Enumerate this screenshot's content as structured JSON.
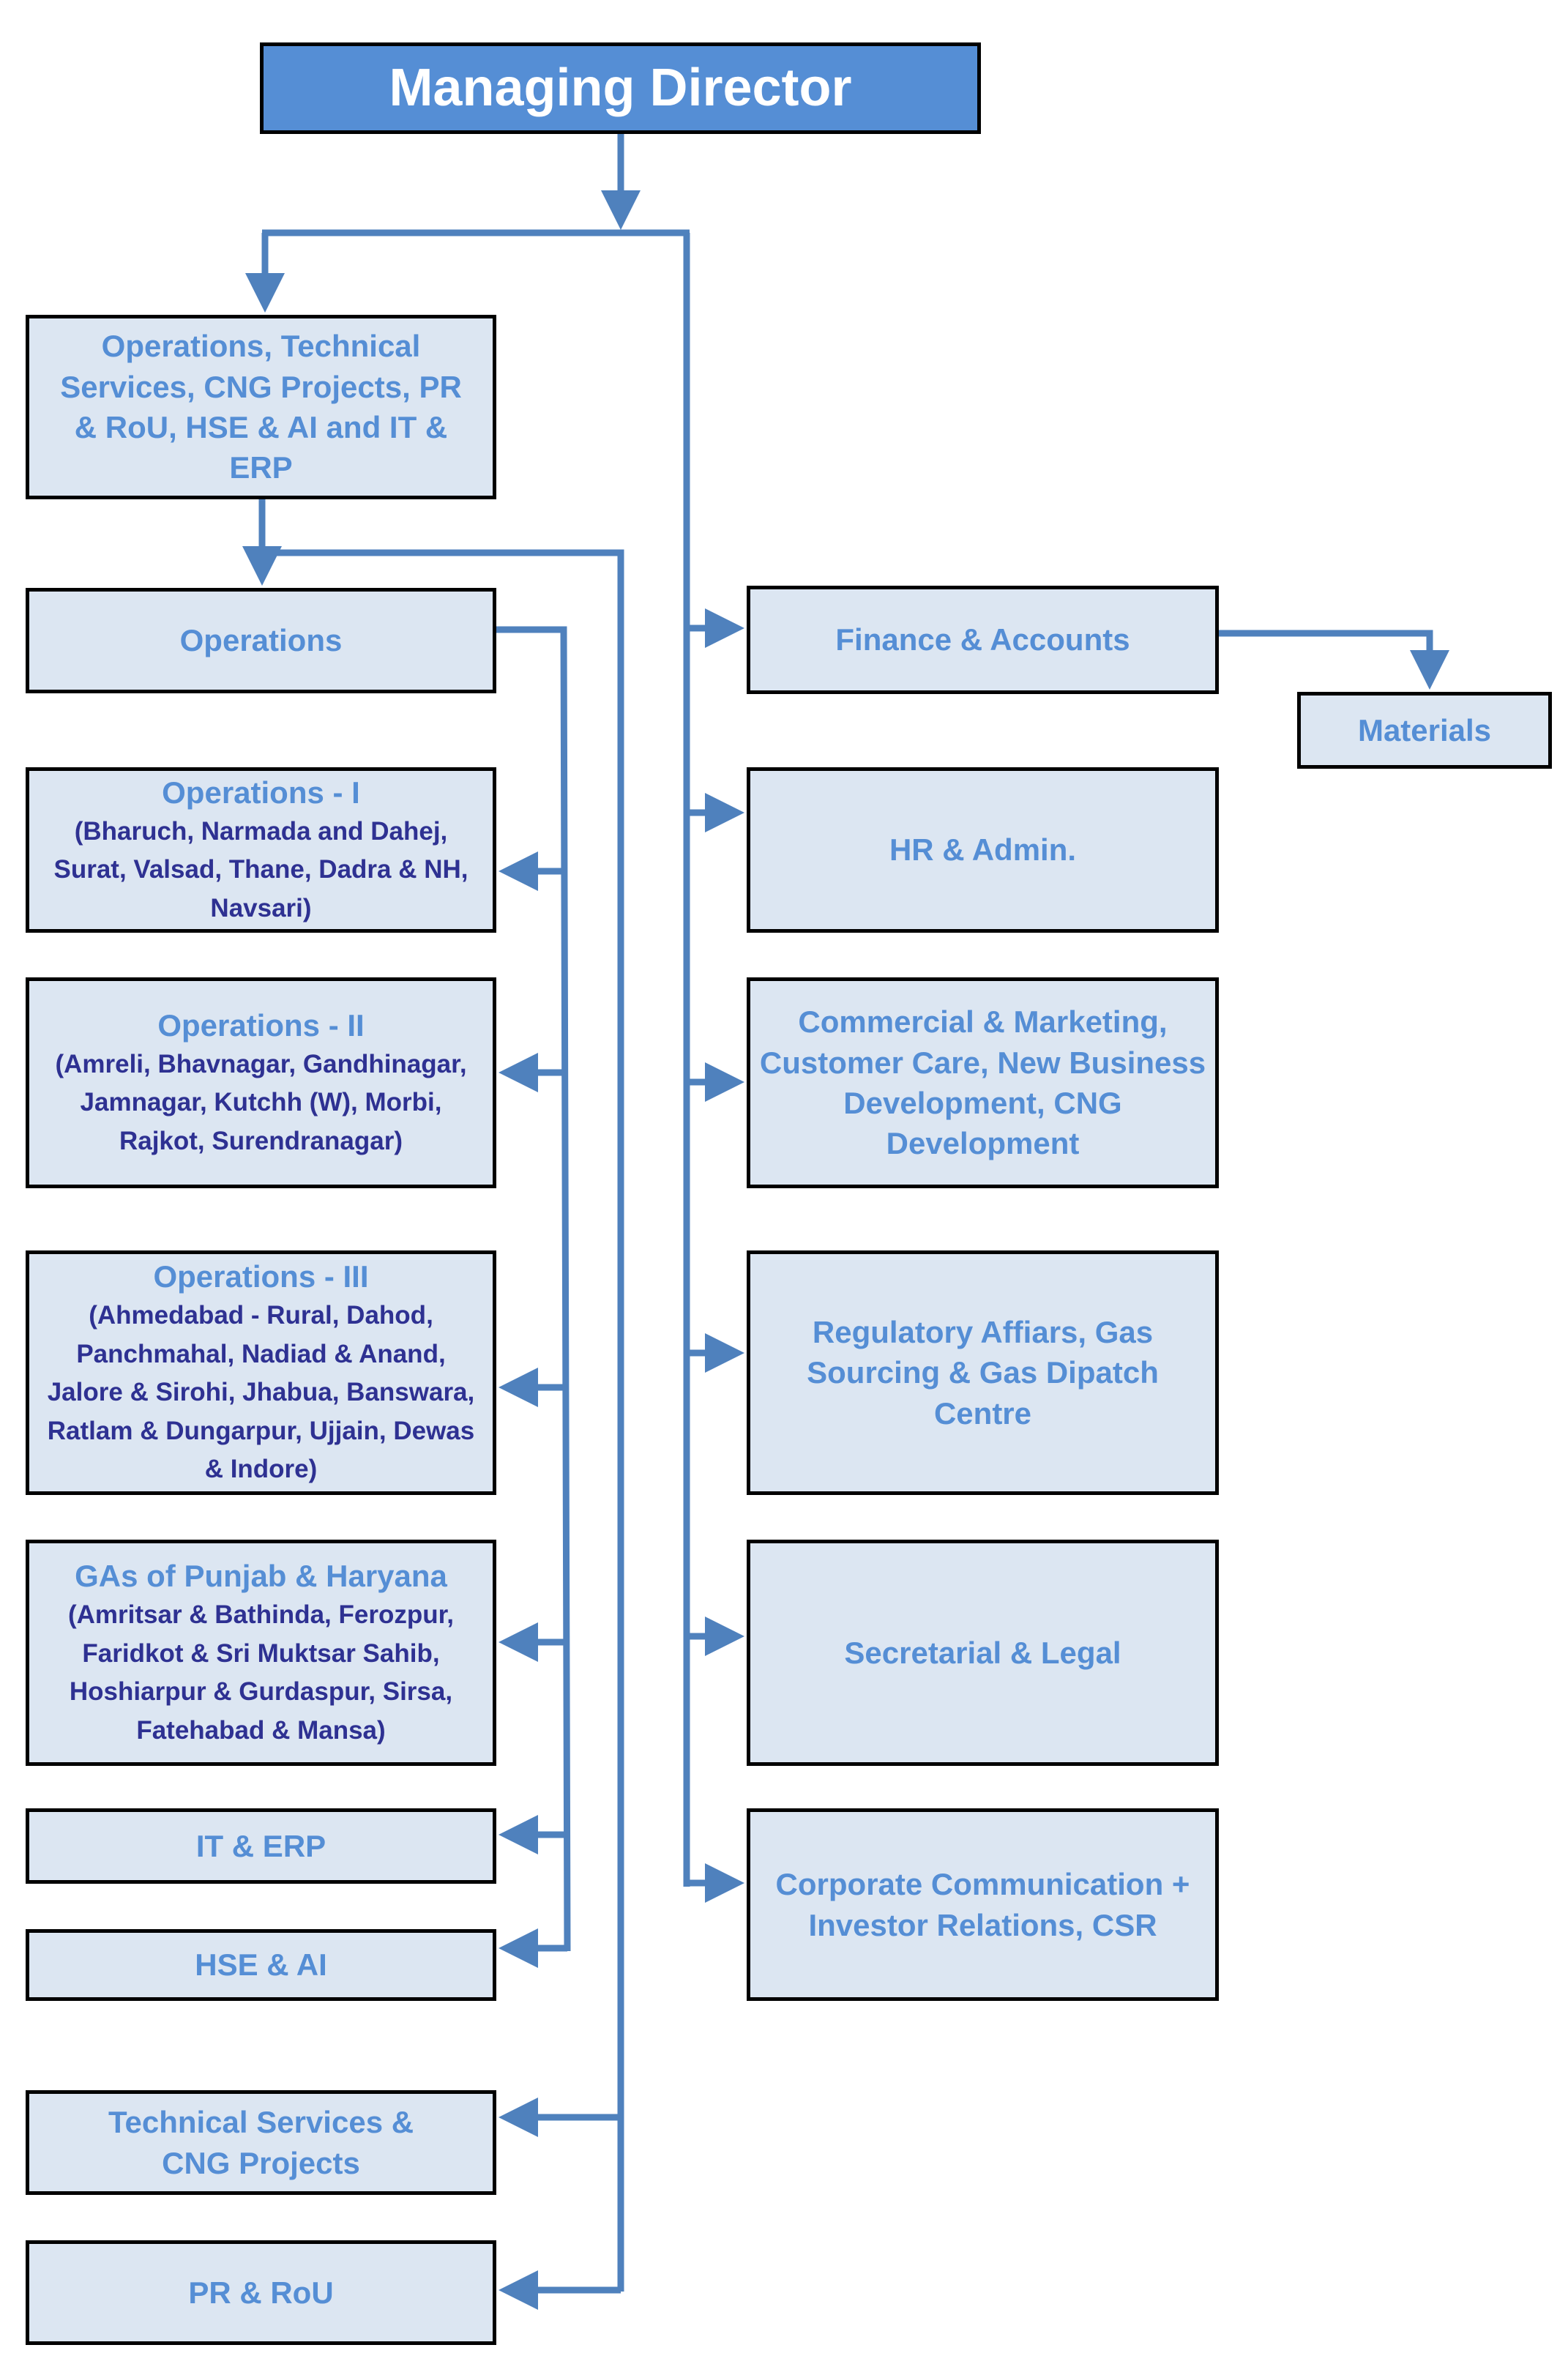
{
  "colors": {
    "connector": "#4f81bd",
    "box_fill": "#dce6f2",
    "box_border": "#000000",
    "title_text": "#558ed5",
    "subtitle_text": "#2e3192",
    "root_fill": "#558ed5",
    "root_text": "#ffffff"
  },
  "root": {
    "label": "Managing Director"
  },
  "left_branch": {
    "head": {
      "label": "Operations, Technical Services, CNG Projects, PR & RoU, HSE & AI and IT & ERP"
    },
    "operations": {
      "label": "Operations"
    },
    "ops_children": [
      {
        "title": "Operations - I",
        "detail": "(Bharuch, Narmada and Dahej, Surat, Valsad, Thane, Dadra & NH, Navsari)"
      },
      {
        "title": "Operations - II",
        "detail": "(Amreli, Bhavnagar, Gandhinagar, Jamnagar, Kutchh (W), Morbi, Rajkot, Surendranagar)"
      },
      {
        "title": "Operations - III",
        "detail": "(Ahmedabad - Rural, Dahod, Panchmahal, Nadiad & Anand, Jalore & Sirohi, Jhabua, Banswara, Ratlam & Dungarpur, Ujjain, Dewas & Indore)"
      },
      {
        "title": "GAs of Punjab & Haryana",
        "detail": "(Amritsar & Bathinda, Ferozpur, Faridkot & Sri Muktsar Sahib, Hoshiarpur & Gurdaspur, Sirsa, Fatehabad & Mansa)"
      },
      {
        "title": "IT & ERP"
      },
      {
        "title": "HSE & AI"
      }
    ],
    "other_children": [
      {
        "label": "Technical Services & CNG Projects"
      },
      {
        "label": "PR & RoU"
      }
    ]
  },
  "right_branch": [
    {
      "label": "Finance & Accounts"
    },
    {
      "label": "HR & Admin."
    },
    {
      "label": "Commercial & Marketing, Customer Care, New Business Development, CNG Development"
    },
    {
      "label": "Regulatory Affiars, Gas Sourcing & Gas Dipatch Centre"
    },
    {
      "label": "Secretarial & Legal"
    },
    {
      "label": "Corporate Communication + Investor Relations, CSR"
    }
  ],
  "finance_child": {
    "label": "Materials"
  }
}
